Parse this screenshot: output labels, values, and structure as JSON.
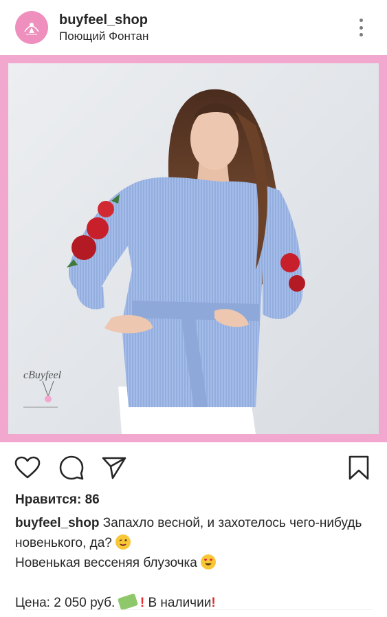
{
  "post": {
    "username": "buyfeel_shop",
    "location": "Поющий Фонтан",
    "logo_text": "cBuyfeel",
    "likes_text": "Нравится: 86",
    "caption_user": "buyfeel_shop",
    "caption_line1": "Запахло весной, и захотелось чего-нибудь новенького, да?",
    "caption_line2": "Новенькая вессеняя блузочка",
    "price_text": "Цена: 2 050 руб.",
    "availability_text": "В наличии",
    "watermark_text": "cBuyfeel"
  },
  "colors": {
    "frame_pink": "#f2a7cf",
    "avatar_pink": "#ee8fbd",
    "blouse_blue": "#9fb8e6",
    "rose_red": "#c8202a",
    "alert_red": "#e0282e"
  },
  "icons": {
    "like": "heart-icon",
    "comment": "comment-icon",
    "share": "send-icon",
    "save": "bookmark-icon",
    "more": "more-vertical-icon"
  }
}
